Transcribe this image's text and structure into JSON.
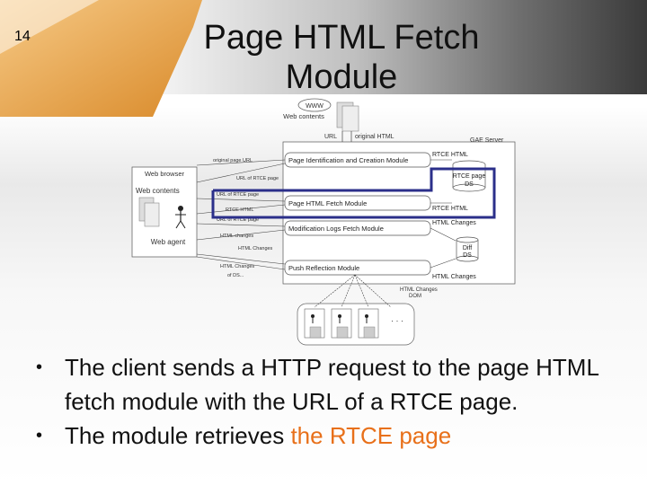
{
  "slide": {
    "number": "14",
    "title_line1": "Page HTML Fetch",
    "title_line2": "Module"
  },
  "diagram": {
    "www_label": "WWW",
    "web_contents_top": "Web contents",
    "url_label": "URL",
    "original_html_label": "original HTML",
    "gae_server": "GAE Server",
    "web_browser": "Web browser",
    "web_contents_left": "Web contents",
    "web_agent": "Web agent",
    "modules": [
      "Page Identification and Creation Module",
      "Page HTML Fetch Module",
      "Modification Logs Fetch Module",
      "Push Reflection Module"
    ],
    "rtce_page_ds": [
      "RTCE page",
      "DS"
    ],
    "diff_ds": [
      "Diff",
      "DS"
    ],
    "right_labels": [
      "RTCE HTML",
      "RTCE HTML",
      "HTML Changes",
      "HTML Changes"
    ],
    "left_labels": [
      "original page URL",
      "URL of RTCE page",
      "URL of RTCE page",
      "RTCE HTML",
      "URL of RTCE page",
      "HTML changes",
      "HTML Changes",
      "HTML Changes",
      "HTML changes",
      "of DS..."
    ],
    "clients_label": [
      "HTML Changes",
      "DOM"
    ],
    "ellipsis": "· · ·"
  },
  "bullets": [
    {
      "text": "The client sends a HTTP request to the page HTML fetch module with the URL of a RTCE page."
    },
    {
      "text_before": "The module retrieves ",
      "text_highlight": "the RTCE page"
    }
  ],
  "colors": {
    "highlight": "#e8701a",
    "accent_box": "#2b2f8a",
    "flag": "#e8a040"
  }
}
